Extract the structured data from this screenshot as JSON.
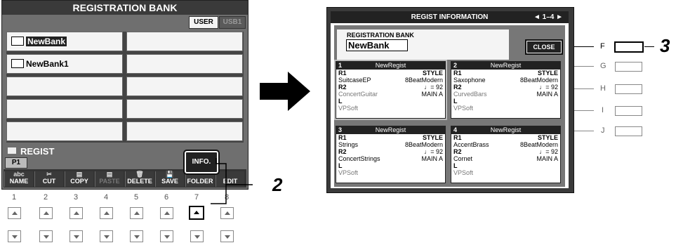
{
  "left_screen": {
    "title": "REGISTRATION BANK",
    "tabs": [
      "USER",
      "USB1"
    ],
    "banks": [
      "NewBank",
      "NewBank1",
      "",
      "",
      "",
      "",
      "",
      "",
      "",
      ""
    ],
    "folder_label": "REGIST",
    "page": "P1",
    "info_button": "INFO.",
    "function_buttons": [
      {
        "glyph": "abc",
        "label": "NAME"
      },
      {
        "glyph": "✂",
        "label": "CUT"
      },
      {
        "glyph": "▤",
        "label": "COPY"
      },
      {
        "glyph": "▤",
        "label": "PASTE"
      },
      {
        "glyph": "🗑",
        "label": "DELETE"
      },
      {
        "glyph": "💾",
        "label": "SAVE"
      },
      {
        "glyph": "",
        "label": "FOLDER"
      },
      {
        "glyph": "",
        "label": "EDIT"
      }
    ],
    "numbers": [
      "1",
      "2",
      "3",
      "4",
      "5",
      "6",
      "7",
      "8"
    ]
  },
  "right_screen": {
    "title": "REGIST INFORMATION",
    "page_indicator": "◄ 1–4 ►",
    "bank_label": "REGISTRATION BANK",
    "bank_name": "NewBank",
    "close_button": "CLOSE",
    "entries": [
      {
        "num": "1",
        "name": "NewRegist",
        "r1": "SuitcaseEP",
        "style": "8BeatModern",
        "tempo": "♩= 92",
        "r2": "ConcertGuitar",
        "section": "MAIN A",
        "l": "VPSoft"
      },
      {
        "num": "2",
        "name": "NewRegist",
        "r1": "Saxophone",
        "style": "8BeatModern",
        "tempo": "♩= 92",
        "r2": "CurvedBars",
        "section": "MAIN A",
        "l": "VPSoft"
      },
      {
        "num": "3",
        "name": "NewRegist",
        "r1": "Strings",
        "style": "8BeatModern",
        "tempo": "♩= 92",
        "r2": "ConcertStrings",
        "section": "MAIN A",
        "l": "VPSoft"
      },
      {
        "num": "4",
        "name": "NewRegist",
        "r1": "AccentBrass",
        "style": "8BeatModern",
        "tempo": "♩= 92",
        "r2": "Cornet",
        "section": "MAIN A",
        "l": "VPSoft"
      }
    ],
    "labels": {
      "r1": "R1",
      "r2": "R2",
      "l": "L",
      "style": "STYLE"
    },
    "side_buttons": [
      "F",
      "G",
      "H",
      "I",
      "J"
    ]
  },
  "callouts": {
    "two": "2",
    "three": "3"
  }
}
